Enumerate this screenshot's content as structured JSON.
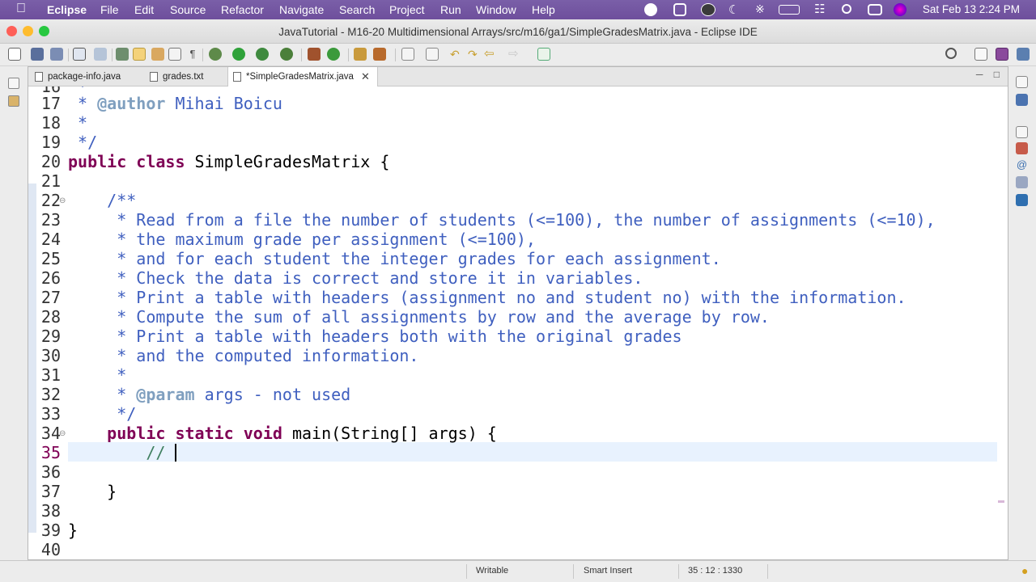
{
  "menubar": {
    "app": "Eclipse",
    "items": [
      "File",
      "Edit",
      "Source",
      "Refactor",
      "Navigate",
      "Search",
      "Project",
      "Run",
      "Window",
      "Help"
    ],
    "clock": "Sat Feb 13  2:24 PM"
  },
  "window": {
    "title": "JavaTutorial - M16-20 Multidimensional Arrays/src/m16/ga1/SimpleGradesMatrix.java - Eclipse IDE"
  },
  "tabs": [
    {
      "label": "package-info.java",
      "active": false
    },
    {
      "label": "grades.txt",
      "active": false
    },
    {
      "label": "*SimpleGradesMatrix.java",
      "active": true
    }
  ],
  "editor": {
    "partial_top_line": "16",
    "lines": [
      {
        "no": "17",
        "text": " * @author Mihai Boicu"
      },
      {
        "no": "18",
        "text": " *"
      },
      {
        "no": "19",
        "text": " */"
      },
      {
        "no": "20",
        "text": "public class SimpleGradesMatrix {"
      },
      {
        "no": "21",
        "text": ""
      },
      {
        "no": "22",
        "text": "    /**"
      },
      {
        "no": "23",
        "text": "     * Read from a file the number of students (<=100), the number of assignments (<=10),"
      },
      {
        "no": "24",
        "text": "     * the maximum grade per assignment (<=100),"
      },
      {
        "no": "25",
        "text": "     * and for each student the integer grades for each assignment."
      },
      {
        "no": "26",
        "text": "     * Check the data is correct and store it in variables."
      },
      {
        "no": "27",
        "text": "     * Print a table with headers (assignment no and student no) with the information."
      },
      {
        "no": "28",
        "text": "     * Compute the sum of all assignments by row and the average by row."
      },
      {
        "no": "29",
        "text": "     * Print a table with headers both with the original grades"
      },
      {
        "no": "30",
        "text": "     * and the computed information."
      },
      {
        "no": "31",
        "text": "     *"
      },
      {
        "no": "32",
        "text": "     * @param args - not used"
      },
      {
        "no": "33",
        "text": "     */"
      },
      {
        "no": "34",
        "text": "    public static void main(String[] args) {"
      },
      {
        "no": "35",
        "text": "        // "
      },
      {
        "no": "36",
        "text": ""
      },
      {
        "no": "37",
        "text": "    }"
      },
      {
        "no": "38",
        "text": ""
      },
      {
        "no": "39",
        "text": "}"
      },
      {
        "no": "40",
        "text": ""
      }
    ]
  },
  "status": {
    "writable": "Writable",
    "insert_mode": "Smart Insert",
    "position": "35 : 12 : 1330"
  },
  "colors": {
    "keyword": "#7f0055",
    "javadoc": "#3f5fbf",
    "javadoc_tag": "#7f9fbf",
    "comment": "#3f7f5f",
    "current_line": "#e8f2fe"
  }
}
